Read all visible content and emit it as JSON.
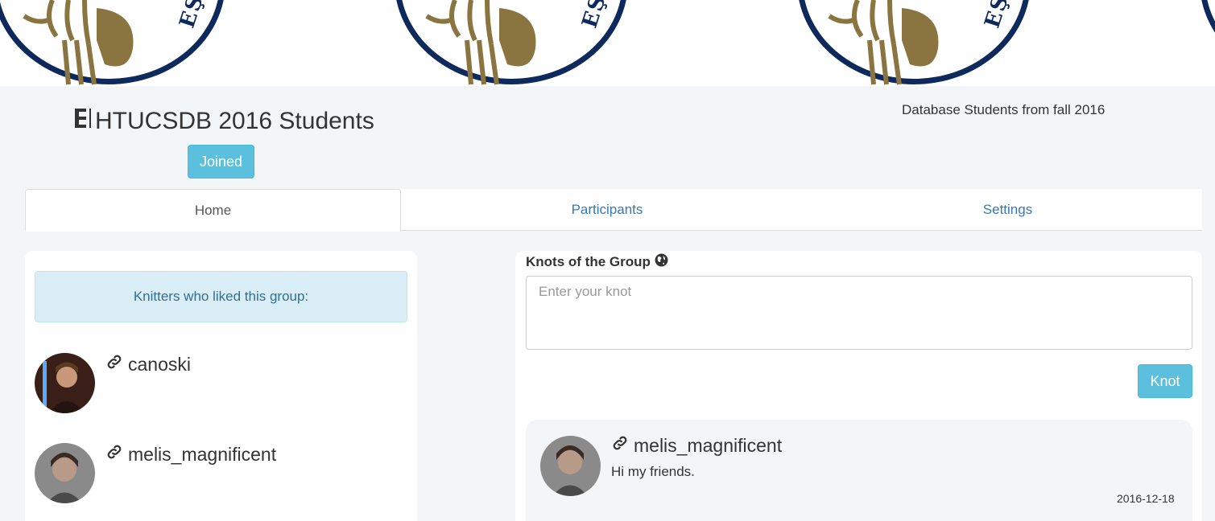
{
  "group": {
    "title": "HTUCSDB 2016 Students",
    "joined_label": "Joined",
    "description": "Database Students from fall 2016"
  },
  "tabs": [
    {
      "label": "Home",
      "active": true
    },
    {
      "label": "Participants",
      "active": false
    },
    {
      "label": "Settings",
      "active": false
    }
  ],
  "likes": {
    "heading": "Knitters who liked this group:",
    "users": [
      {
        "name": "canoski"
      },
      {
        "name": "melis_magnificent"
      }
    ]
  },
  "knots": {
    "heading": "Knots of the Group",
    "input_placeholder": "Enter your knot",
    "submit_label": "Knot",
    "posts": [
      {
        "author": "melis_magnificent",
        "message": "Hi my friends.",
        "date": "2016-12-18"
      }
    ]
  },
  "banner": {
    "seal_text": "EŞİ"
  },
  "colors": {
    "accent": "#5bc0de",
    "link": "#337ab7",
    "info_bg": "#d9edf7",
    "info_text": "#31708f",
    "seal_navy": "#0e2a5c",
    "seal_gold": "#8a7540"
  }
}
